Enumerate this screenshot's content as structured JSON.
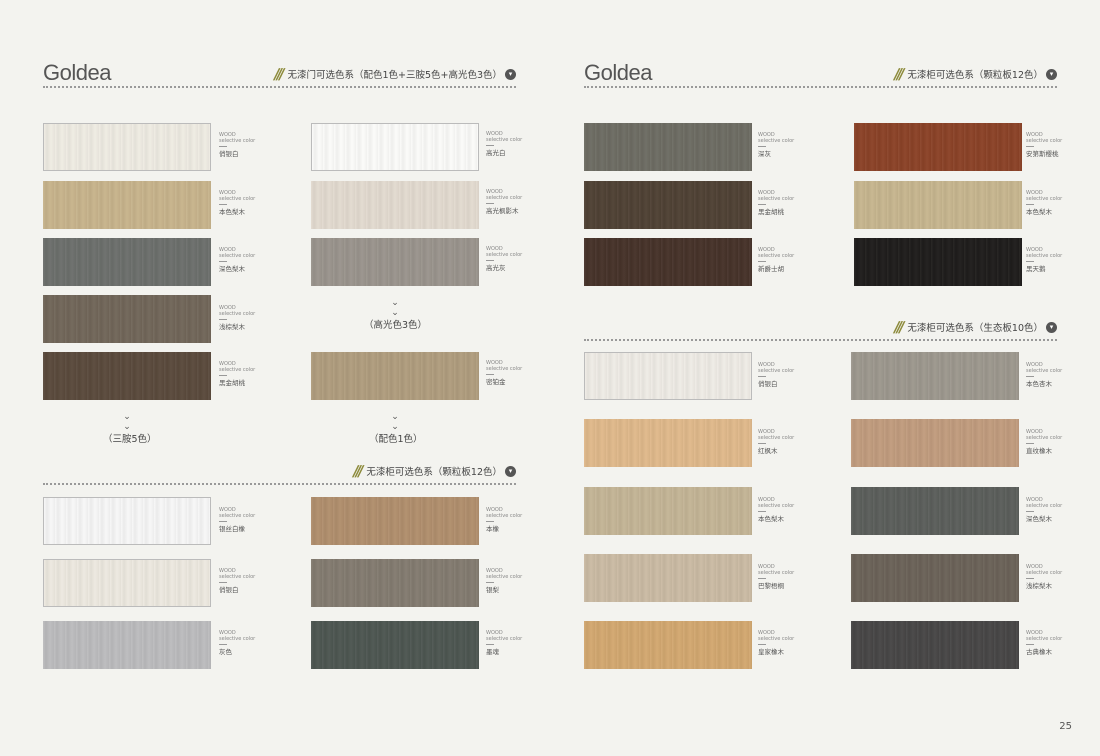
{
  "brand": "Goldea",
  "label_en_1": "WOOD",
  "label_en_2": "selective color",
  "page_number": "25",
  "headers": {
    "door": "无漆门可选色系（配色1色+三胺5色+高光色3色）",
    "left_cabinet": "无漆柜可选色系（颗粒板12色）",
    "right_cabinet_particle": "无漆柜可选色系（颗粒板12色）",
    "right_cabinet_eco": "无漆柜可选色系（生态板10色）"
  },
  "groups": {
    "melamine": "（三胺5色）",
    "gloss": "（高光色3色）",
    "accent": "（配色1色）"
  },
  "swatches": {
    "door_melamine": [
      {
        "name": "俏银白",
        "color": "#efece3"
      },
      {
        "name": "本色梨木",
        "color": "#c8b48c"
      },
      {
        "name": "深色梨木",
        "color": "#6c6f6c"
      },
      {
        "name": "浅棕梨木",
        "color": "#716659"
      },
      {
        "name": "黑金胡桃",
        "color": "#5a4a3c"
      }
    ],
    "door_gloss": [
      {
        "name": "高光白",
        "color": "#fbfbf9"
      },
      {
        "name": "高光枫影木",
        "color": "#e3dbd0"
      },
      {
        "name": "高光灰",
        "color": "#9a948d"
      }
    ],
    "door_accent": [
      {
        "name": "密铂金",
        "color": "#b09d7e"
      }
    ],
    "left_cabinet": [
      {
        "name": "银丝白橡",
        "color": "#f7f7f7"
      },
      {
        "name": "本橡",
        "color": "#b18f6d"
      },
      {
        "name": "俏银白",
        "color": "#ede9e0"
      },
      {
        "name": "银梨",
        "color": "#837b70"
      },
      {
        "name": "灰色",
        "color": "#bcbcbe"
      },
      {
        "name": "墨魂",
        "color": "#4d5651"
      }
    ],
    "right_particle": [
      {
        "name": "深灰",
        "color": "#6d6c63"
      },
      {
        "name": "安第斯樱桃",
        "color": "#8b4227"
      },
      {
        "name": "黑金胡桃",
        "color": "#4f4134"
      },
      {
        "name": "本色梨木",
        "color": "#c7b68f"
      },
      {
        "name": "新爵士胡",
        "color": "#463229"
      },
      {
        "name": "黑天鹅",
        "color": "#1e1c1b"
      }
    ],
    "right_eco": [
      {
        "name": "俏银白",
        "color": "#efece6"
      },
      {
        "name": "本色杏木",
        "color": "#9d988e"
      },
      {
        "name": "红枫木",
        "color": "#e0b98b"
      },
      {
        "name": "直纹橡木",
        "color": "#c19c7e"
      },
      {
        "name": "本色梨木",
        "color": "#c4b596"
      },
      {
        "name": "深色梨木",
        "color": "#5b5e5b"
      },
      {
        "name": "巴黎梧桐",
        "color": "#cbbba4"
      },
      {
        "name": "浅棕梨木",
        "color": "#6b6258"
      },
      {
        "name": "皇家橡木",
        "color": "#d3a870"
      },
      {
        "name": "古典橡木",
        "color": "#474646"
      }
    ]
  }
}
